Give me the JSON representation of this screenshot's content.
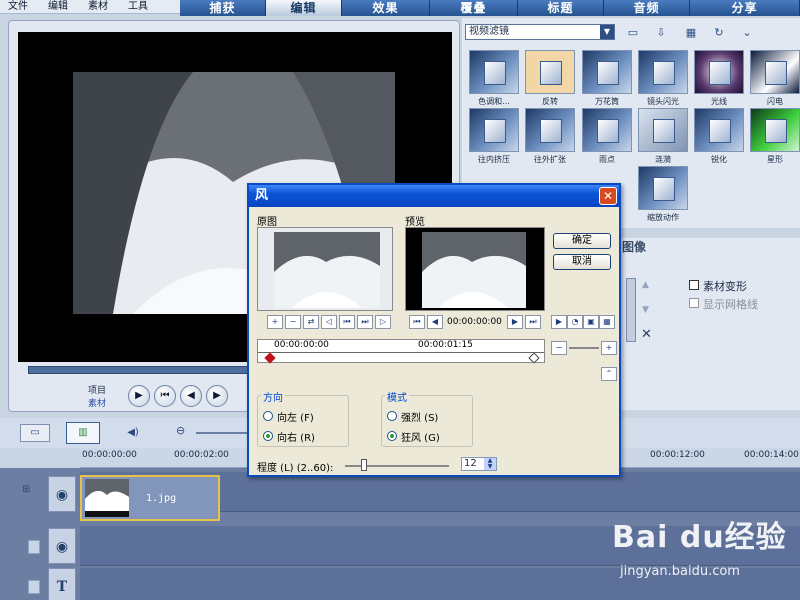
{
  "menu": [
    "文件",
    "编辑",
    "素材",
    "工具"
  ],
  "steps": [
    {
      "label": "捕获",
      "active": false
    },
    {
      "label": "编辑",
      "active": true
    },
    {
      "label": "效果",
      "active": false
    },
    {
      "label": "覆叠",
      "active": false
    },
    {
      "label": "标题",
      "active": false
    },
    {
      "label": "音频",
      "active": false
    },
    {
      "label": "分享",
      "active": false
    }
  ],
  "player": {
    "label_project": "项目",
    "label_clip": "素材",
    "controls": [
      "play-icon",
      "start-icon",
      "prev-frame-icon",
      "next-frame-icon"
    ]
  },
  "effects": {
    "category": "视频滤镜",
    "items": [
      "色调和...",
      "反转",
      "万花筒",
      "镜头闪光",
      "光线",
      "闪电",
      "往内挤压",
      "往外扩张",
      "雨点",
      "涟漪",
      "锐化",
      "星形",
      "",
      "",
      "",
      "缩放动作"
    ]
  },
  "attributes": {
    "title": "图像",
    "clip_transform": "素材变形",
    "show_grid": "显示网格线"
  },
  "timeline": {
    "ruler": [
      "00:00:00:00",
      "00:00:02:00",
      "00:00:12:00",
      "00:00:14:00"
    ],
    "clip_name": "1.jpg"
  },
  "dialog": {
    "title": "风",
    "close_glyph": "✕",
    "original_label": "原图",
    "preview_label": "预览",
    "ok": "确定",
    "cancel": "取消",
    "preview_time": "00:00:00:00",
    "track_start": "00:00:00:00",
    "track_end": "00:00:01:15",
    "direction_title": "方向",
    "dir_left": "向左 (F)",
    "dir_right": "向右 (R)",
    "mode_title": "模式",
    "mode_strong": "强烈 (S)",
    "mode_gale": "狂风 (G)",
    "degree_label": "程度 (L)  (2..60):",
    "degree_value": "12"
  },
  "watermark": {
    "logo": "Bai du经验",
    "url": "jingyan.baidu.com"
  },
  "colors": {
    "accent": "#0b53d6",
    "step_bar": "#2f5d9a",
    "timeline_bg": "#6c7fa3",
    "clip_border": "#e6c24b"
  }
}
